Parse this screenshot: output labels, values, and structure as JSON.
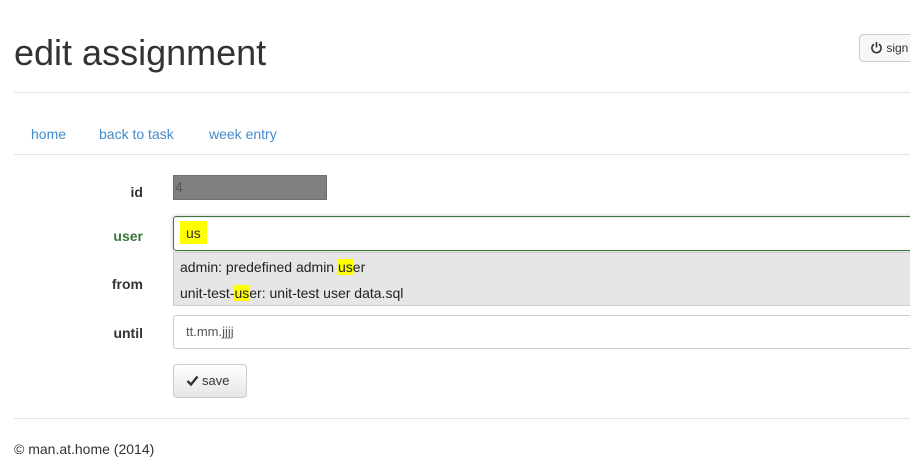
{
  "header": {
    "title": "edit assignment",
    "signout_label": "sign"
  },
  "nav": {
    "items": [
      {
        "label": "home"
      },
      {
        "label": "back to task"
      },
      {
        "label": "week entry"
      }
    ]
  },
  "form": {
    "id": {
      "label": "id",
      "value": "4"
    },
    "user": {
      "label": "user",
      "value": "us",
      "suggestions": [
        {
          "before": "admin: predefined admin ",
          "match": "us",
          "after": "er"
        },
        {
          "before": "unit-test-",
          "match": "us",
          "after": "er: unit-test user data.sql"
        }
      ]
    },
    "from": {
      "label": "from"
    },
    "until": {
      "label": "until",
      "placeholder": "tt.mm.jjjj"
    },
    "save_label": "save"
  },
  "footer": {
    "text": "© man.at.home (2014)"
  },
  "colors": {
    "link": "#428bca",
    "success": "#3c763d",
    "highlight": "#ffff00",
    "disabled_field": "#808080"
  }
}
